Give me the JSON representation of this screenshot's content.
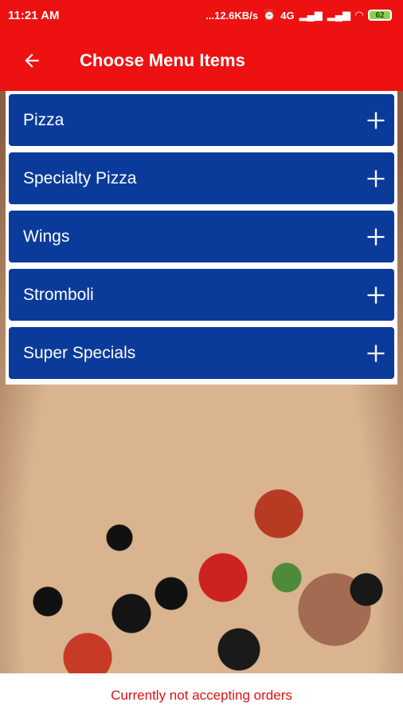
{
  "status_bar": {
    "time": "11:21 AM",
    "network_speed": "...12.6KB/s",
    "alarm_icon": "alarm-icon",
    "volte_label": "4G",
    "battery_level": "62"
  },
  "app_bar": {
    "title": "Choose Menu Items",
    "back_icon": "arrow-left-icon"
  },
  "menu": {
    "items": [
      {
        "label": "Pizza"
      },
      {
        "label": "Specialty Pizza"
      },
      {
        "label": "Wings"
      },
      {
        "label": "Stromboli"
      },
      {
        "label": "Super Specials"
      }
    ]
  },
  "footer": {
    "message": "Currently not accepting orders"
  },
  "colors": {
    "app_bar": "#ee1111",
    "menu_item": "#0b3b9a",
    "footer_text": "#e01010"
  }
}
